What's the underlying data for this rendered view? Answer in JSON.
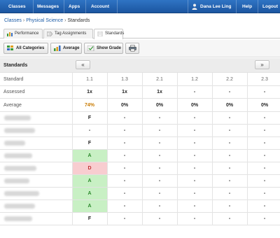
{
  "nav": {
    "classes": "Classes",
    "messages": "Messages",
    "apps": "Apps",
    "account": "Account",
    "user": "Dana Lee Ling",
    "help": "Help",
    "logout": "Logout"
  },
  "breadcrumb": {
    "root": "Classes",
    "course": "Physical Science",
    "current": "Standards",
    "sep": "›"
  },
  "tabs": [
    {
      "label": "Performance",
      "icon": "bar-chart-icon",
      "active": false
    },
    {
      "label": "Tag Assignments",
      "icon": "tag-icon",
      "active": false
    },
    {
      "label": "Standards",
      "icon": "document-icon",
      "active": true
    }
  ],
  "toolbar": {
    "all_categories": "All Categories",
    "average": "Average",
    "show_grade": "Show Grade",
    "print_icon": "printer-icon"
  },
  "grid": {
    "title": "Standards",
    "prev": "«",
    "next": "»",
    "standard_label": "Standard",
    "assessed_label": "Assessed",
    "average_label": "Average",
    "columns": [
      "1.1",
      "1.3",
      "2.1",
      "1.2",
      "2.2",
      "2.3"
    ],
    "assessed": [
      "1x",
      "1x",
      "1x",
      "-",
      "-",
      "-"
    ],
    "average": [
      "74%",
      "0%",
      "0%",
      "0%",
      "0%",
      "0%"
    ],
    "students": [
      {
        "scores": [
          "F",
          "-",
          "-",
          "-",
          "-",
          "-"
        ]
      },
      {
        "scores": [
          "-",
          "-",
          "-",
          "-",
          "-",
          "-"
        ]
      },
      {
        "scores": [
          "F",
          "-",
          "-",
          "-",
          "-",
          "-"
        ]
      },
      {
        "scores": [
          "A",
          "-",
          "-",
          "-",
          "-",
          "-"
        ]
      },
      {
        "scores": [
          "D",
          "-",
          "-",
          "-",
          "-",
          "-"
        ]
      },
      {
        "scores": [
          "A",
          "-",
          "-",
          "-",
          "-",
          "-"
        ]
      },
      {
        "scores": [
          "A",
          "-",
          "-",
          "-",
          "-",
          "-"
        ]
      },
      {
        "scores": [
          "A",
          "-",
          "-",
          "-",
          "-",
          "-"
        ]
      },
      {
        "scores": [
          "F",
          "-",
          "-",
          "-",
          "-",
          "-"
        ]
      }
    ]
  },
  "colors": {
    "nav_blue": "#1f5fae",
    "average_first": "#c87a00",
    "grade_green_bg": "#c8f0c4",
    "grade_red_bg": "#f8cdd0"
  }
}
